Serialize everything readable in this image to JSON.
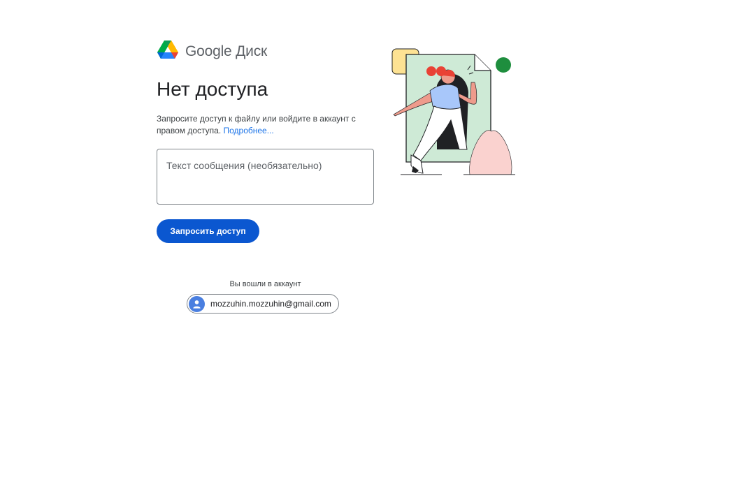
{
  "header": {
    "app_name": "Google Диск",
    "logo_icon": "google-drive-icon"
  },
  "main": {
    "title": "Нет доступа",
    "description": "Запросите доступ к файлу или войдите в аккаунт с правом доступа.",
    "learn_more": "Подробнее...",
    "message_placeholder": "Текст сообщения (необязательно)",
    "message_value": "",
    "request_button": "Запросить доступ"
  },
  "account": {
    "label": "Вы вошли в аккаунт",
    "email": "mozzuhin.mozzuhin@gmail.com",
    "avatar_icon": "person-icon"
  },
  "colors": {
    "primary_button": "#0b57d0",
    "link": "#1a73e8",
    "illustration_green": "#ceead6",
    "illustration_pink": "#fad2cf",
    "illustration_yellow": "#fde293",
    "dot_green": "#1e8e3e"
  }
}
